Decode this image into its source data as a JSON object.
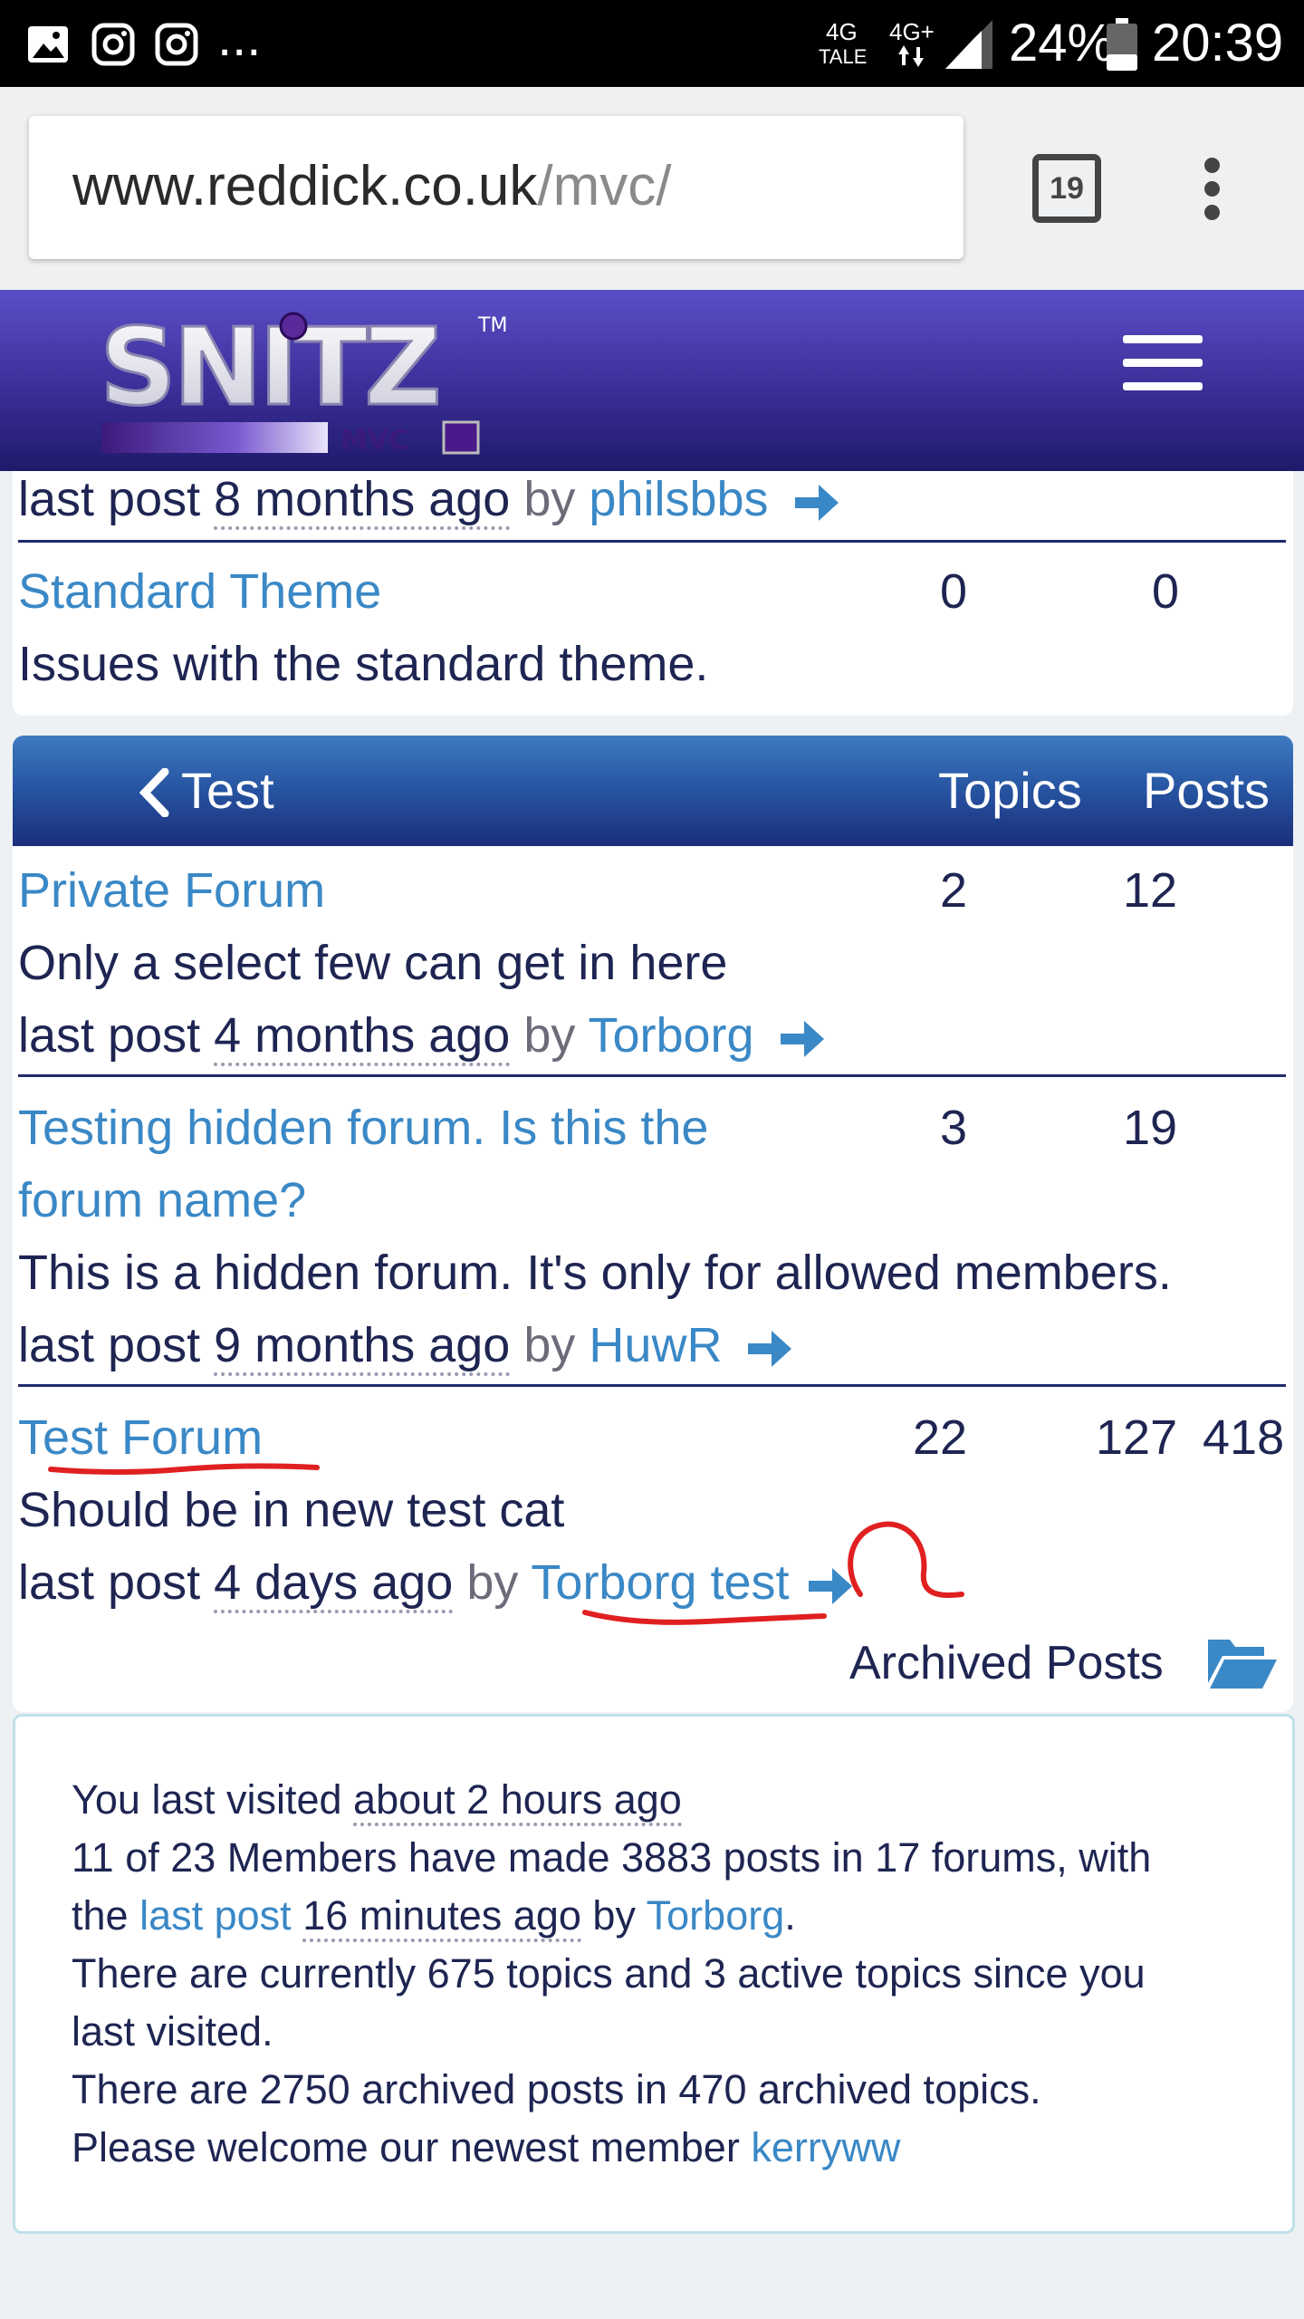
{
  "status_bar": {
    "network_top": "4G",
    "network_bottom": "TALE",
    "network2": "4G+",
    "battery": "24%",
    "time": "20:39",
    "more": "..."
  },
  "browser": {
    "url_host": "www.reddick.co.uk",
    "url_path": "/mvc/",
    "tab_count": "19"
  },
  "header": {
    "logo_text": "SNITZ",
    "logo_sub": "MVC",
    "logo_tm": "TM"
  },
  "top_section": {
    "partial_last_post": {
      "prefix": "last post",
      "time": "8 months ago",
      "by": "by",
      "user": "philsbbs"
    },
    "standard_theme": {
      "name": "Standard Theme",
      "topics": "0",
      "posts": "0",
      "description": "Issues with the standard theme."
    }
  },
  "category": {
    "title": "Test",
    "col_topics": "Topics",
    "col_posts": "Posts",
    "forums": [
      {
        "name": "Private Forum",
        "topics": "2",
        "posts": "12",
        "description": "Only a select few can get in here",
        "last_post_prefix": "last post",
        "last_post_time": "4 months ago",
        "by": "by",
        "last_post_user": "Torborg"
      },
      {
        "name_line1": "Testing hidden forum. Is this the",
        "name_line2": "forum name?",
        "topics": "3",
        "posts": "19",
        "description": "This is a hidden forum. It's only for allowed members.",
        "last_post_prefix": "last post",
        "last_post_time": "9 months ago",
        "by": "by",
        "last_post_user": "HuwR"
      },
      {
        "name": "Test Forum",
        "topics": "22",
        "posts": "127",
        "extra": "418",
        "description": "Should be in new test cat",
        "last_post_prefix": "last post",
        "last_post_time": "4 days ago",
        "by": "by",
        "last_post_user": "Torborg test"
      }
    ],
    "archived_posts": "Archived Posts"
  },
  "stats": {
    "line1_prefix": "You last visited",
    "line1_time": "about 2 hours ago",
    "line2": "11 of 23 Members have made 3883 posts in 17 forums, with",
    "line3_prefix": "the",
    "line3_link": "last post",
    "line3_time": "16 minutes ago",
    "line3_by": "by",
    "line3_user": "Torborg",
    "line3_end": ".",
    "line4": "There are currently 675 topics and 3 active topics since you",
    "line5": "last visited.",
    "line6": "There are 2750 archived posts in 470 archived topics.",
    "line7_prefix": "Please welcome our newest member",
    "line7_user": "kerryww"
  },
  "colors": {
    "link": "#3a88c6",
    "text": "#1e2552",
    "header_gradient_top": "#5b4fc8",
    "category_header": "#2653a0",
    "annotation_red": "#e02020"
  }
}
